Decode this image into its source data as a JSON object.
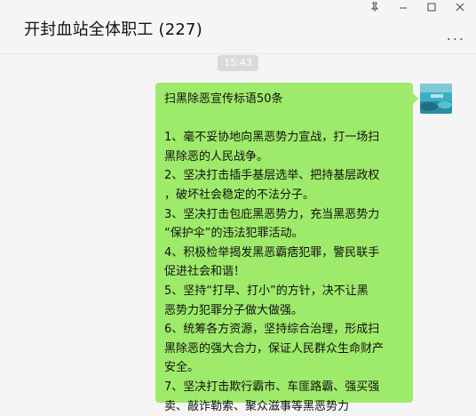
{
  "window": {
    "pin_icon": "pin-icon",
    "minimize_icon": "minimize-icon",
    "maximize_icon": "maximize-icon",
    "close_icon": "close-icon"
  },
  "chat": {
    "title": "开封血站全体职工 (227)",
    "more_label": "...",
    "time_label": "15:43"
  },
  "message": {
    "lines": [
      "扫黑除恶宣传标语50条",
      "",
      "1、毫不妥协地向黑恶势力宣战，打一场扫",
      "黑除恶的人民战争。",
      "2、坚决打击插手基层选举、把持基层政权",
      "，破坏社会稳定的不法分子。",
      "3、坚决打击包庇黑恶势力，充当黑恶势力",
      "“保护伞”的违法犯罪活动。",
      "4、积极检举揭发黑恶霸痞犯罪，警民联手",
      "促进社会和谐！",
      "5、坚持“打早、打小”的方针，决不让黑",
      "恶势力犯罪分子做大做强。",
      "6、统筹各方资源，坚持综合治理，形成扫",
      "黑除恶的强大合力，保证人民群众生命财产",
      "安全。",
      "7、坚决打击欺行霸市、车匪路霸、强买强",
      "卖、敲诈勒索、聚众滋事等黑恶势力"
    ]
  },
  "colors": {
    "bubble": "#9eea6a",
    "background": "#f5f5f5"
  }
}
